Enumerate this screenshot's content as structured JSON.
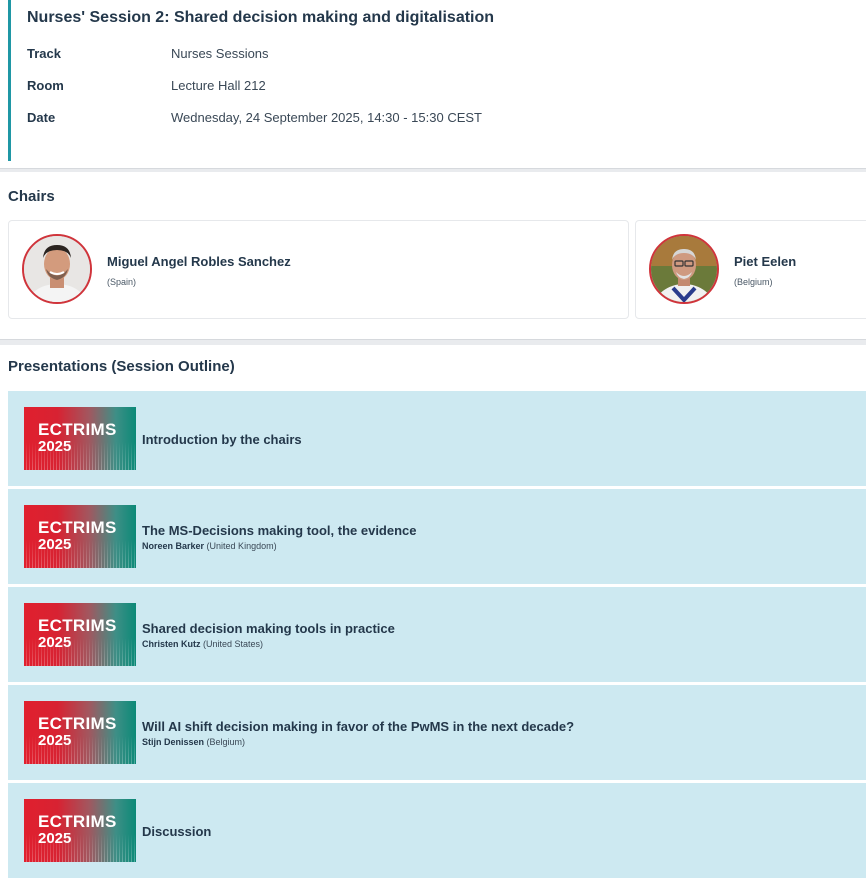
{
  "session": {
    "title": "Nurses' Session 2: Shared decision making and digitalisation",
    "meta": [
      {
        "label": "Track",
        "value": "Nurses Sessions"
      },
      {
        "label": "Room",
        "value": "Lecture Hall 212"
      },
      {
        "label": "Date",
        "value": "Wednesday, 24 September 2025, 14:30 - 15:30 CEST"
      }
    ]
  },
  "chairs": {
    "heading": "Chairs",
    "items": [
      {
        "name": "Miguel Angel Robles Sanchez",
        "country": "(Spain)"
      },
      {
        "name": "Piet Eelen",
        "country": "(Belgium)"
      }
    ]
  },
  "presentations": {
    "heading": "Presentations (Session Outline)",
    "logo": {
      "line1": "ECTRIMS",
      "line2": "2025"
    },
    "items": [
      {
        "title": "Introduction by the chairs",
        "speaker": "",
        "country": ""
      },
      {
        "title": "The MS-Decisions making tool, the evidence",
        "speaker": "Noreen Barker",
        "country": "(United Kingdom)"
      },
      {
        "title": "Shared decision making tools in practice",
        "speaker": "Christen Kutz",
        "country": "(United States)"
      },
      {
        "title": "Will AI shift decision making in favor of the PwMS in the next decade?",
        "speaker": "Stijn Denissen",
        "country": "(Belgium)"
      },
      {
        "title": "Discussion",
        "speaker": "",
        "country": ""
      }
    ]
  },
  "colors": {
    "accent": "#1f97a5",
    "item_bg": "#cde9f1",
    "avatar_border": "#d0343b"
  }
}
